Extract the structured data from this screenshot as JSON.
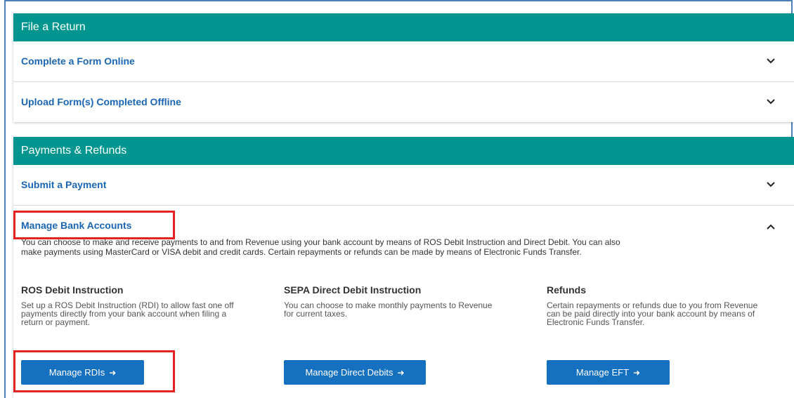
{
  "sections": {
    "file_return": {
      "header": "File a Return",
      "rows": [
        {
          "label": "Complete a Form Online"
        },
        {
          "label": "Upload Form(s) Completed Offline"
        }
      ]
    },
    "payments": {
      "header": "Payments & Refunds",
      "submit_payment": "Submit a Payment",
      "manage_bank": {
        "label": "Manage Bank Accounts",
        "intro_line1": "You can choose to make and receive payments to and from Revenue using your bank account by means of ROS Debit Instruction and Direct Debit. You can also",
        "intro_line2": "make payments using MasterCard or VISA debit and credit cards. Certain repayments or refunds can be made by means of Electronic Funds Transfer.",
        "columns": [
          {
            "title": "ROS Debit Instruction",
            "lines": [
              "Set up a ROS Debit Instruction (RDI) to allow fast one off",
              "payments directly from your bank account when filing a",
              "return or payment."
            ],
            "button": "Manage RDIs"
          },
          {
            "title": "SEPA Direct Debit Instruction",
            "lines": [
              "You can choose to make monthly payments to Revenue",
              "for current taxes."
            ],
            "button": "Manage Direct Debits"
          },
          {
            "title": "Refunds",
            "lines": [
              "Certain repayments or refunds due to you from Revenue",
              "can be paid directly into your bank account by means of",
              "Electronic Funds Transfer."
            ],
            "button": "Manage EFT"
          }
        ]
      }
    }
  },
  "colors": {
    "header_bg": "#00968f",
    "link": "#1a66b3",
    "button_bg": "#1670c0",
    "highlight": "#e52222"
  },
  "icons": {
    "chevron_down": "chevron-down-icon",
    "chevron_up": "chevron-up-icon",
    "arrow_right": "arrow-right-icon"
  }
}
